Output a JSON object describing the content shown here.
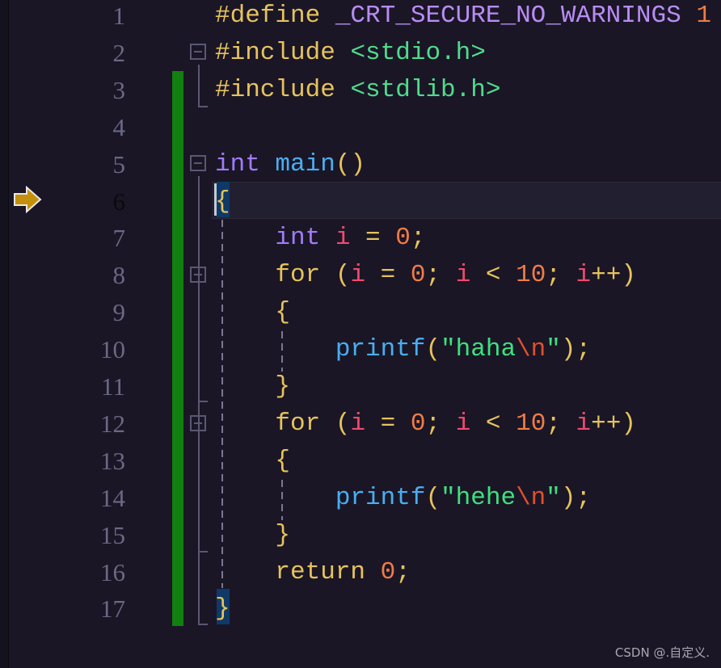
{
  "colors": {
    "background": "#1a1626",
    "change_bar": "#12800f",
    "breakpoint_arrow": "#c48f0c"
  },
  "editor": {
    "current_line": 6,
    "line_numbers": [
      "1",
      "2",
      "3",
      "4",
      "5",
      "6",
      "7",
      "8",
      "9",
      "10",
      "11",
      "12",
      "13",
      "14",
      "15",
      "16",
      "17"
    ],
    "lines": [
      [
        [
          "#define ",
          "#e6c35c"
        ],
        [
          "_CRT_SECURE_NO_WARNINGS",
          "#b98cf4"
        ],
        [
          " ",
          "#e6c35c"
        ],
        [
          "1",
          "#f07c45"
        ]
      ],
      [
        [
          "#include ",
          "#e6c35c"
        ],
        [
          "<stdio.h>",
          "#4fdc8c"
        ]
      ],
      [
        [
          "#include ",
          "#e6c35c"
        ],
        [
          "<stdlib.h>",
          "#4fdc8c"
        ]
      ],
      [],
      [
        [
          "int",
          "#a07cf8"
        ],
        [
          " ",
          "#e6c35c"
        ],
        [
          "main",
          "#4aaef0"
        ],
        [
          "()",
          "#e6c35c"
        ]
      ],
      [
        [
          "{",
          "#e6c35c"
        ]
      ],
      [
        [
          "    ",
          "#e6c35c"
        ],
        [
          "int",
          "#a07cf8"
        ],
        [
          " ",
          "#e6c35c"
        ],
        [
          "i",
          "#f04a6c"
        ],
        [
          " = ",
          "#e6c35c"
        ],
        [
          "0",
          "#f07c45"
        ],
        [
          ";",
          "#e6c35c"
        ]
      ],
      [
        [
          "    for (",
          "#e6c35c"
        ],
        [
          "i",
          "#f04a6c"
        ],
        [
          " = ",
          "#e6c35c"
        ],
        [
          "0",
          "#f07c45"
        ],
        [
          "; ",
          "#e6c35c"
        ],
        [
          "i",
          "#f04a6c"
        ],
        [
          " < ",
          "#e6c35c"
        ],
        [
          "10",
          "#f07c45"
        ],
        [
          "; ",
          "#e6c35c"
        ],
        [
          "i",
          "#f04a6c"
        ],
        [
          "++)",
          "#e6c35c"
        ]
      ],
      [
        [
          "    {",
          "#e6c35c"
        ]
      ],
      [
        [
          "        ",
          "#e6c35c"
        ],
        [
          "printf",
          "#4aaef0"
        ],
        [
          "(",
          "#e6c35c"
        ],
        [
          "\"haha",
          "#3ee07e"
        ],
        [
          "\\n",
          "#e0502e"
        ],
        [
          "\"",
          "#3ee07e"
        ],
        [
          ");",
          "#e6c35c"
        ]
      ],
      [
        [
          "    }",
          "#e6c35c"
        ]
      ],
      [
        [
          "    for (",
          "#e6c35c"
        ],
        [
          "i",
          "#f04a6c"
        ],
        [
          " = ",
          "#e6c35c"
        ],
        [
          "0",
          "#f07c45"
        ],
        [
          "; ",
          "#e6c35c"
        ],
        [
          "i",
          "#f04a6c"
        ],
        [
          " < ",
          "#e6c35c"
        ],
        [
          "10",
          "#f07c45"
        ],
        [
          "; ",
          "#e6c35c"
        ],
        [
          "i",
          "#f04a6c"
        ],
        [
          "++)",
          "#e6c35c"
        ]
      ],
      [
        [
          "    {",
          "#e6c35c"
        ]
      ],
      [
        [
          "        ",
          "#e6c35c"
        ],
        [
          "printf",
          "#4aaef0"
        ],
        [
          "(",
          "#e6c35c"
        ],
        [
          "\"hehe",
          "#3ee07e"
        ],
        [
          "\\n",
          "#e0502e"
        ],
        [
          "\"",
          "#3ee07e"
        ],
        [
          ");",
          "#e6c35c"
        ]
      ],
      [
        [
          "    }",
          "#e6c35c"
        ]
      ],
      [
        [
          "    return ",
          "#e6c35c"
        ],
        [
          "0",
          "#f07c45"
        ],
        [
          ";",
          "#e6c35c"
        ]
      ],
      [
        [
          "}",
          "#e6c35c"
        ]
      ]
    ]
  },
  "icons": {
    "breakpoint": "current-statement-arrow-icon",
    "fold": "collapse-box-icon"
  },
  "watermark": "CSDN @.自定义."
}
